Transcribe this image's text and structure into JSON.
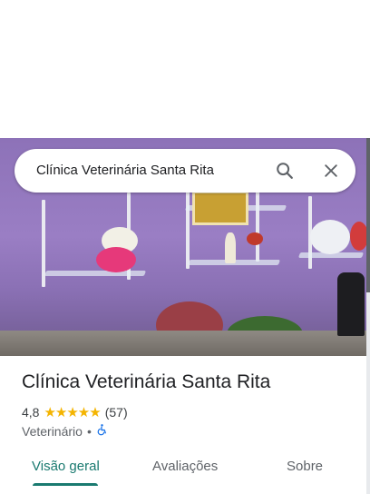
{
  "search": {
    "query": "Clínica Veterinária Santa Rita",
    "search_icon": "search-icon",
    "close_icon": "close-icon"
  },
  "place": {
    "name": "Clínica Veterinária Santa Rita",
    "rating": "4,8",
    "stars": "★★★★★",
    "review_count": "(57)",
    "category": "Veterinário",
    "separator": "•",
    "accessibility_icon": "wheelchair-icon"
  },
  "tabs": [
    {
      "label": "Visão geral",
      "active": true
    },
    {
      "label": "Avaliações",
      "active": false
    },
    {
      "label": "Sobre",
      "active": false
    }
  ],
  "colors": {
    "accent": "#1a7a70",
    "star": "#f4b400",
    "accessibility": "#1a73e8"
  }
}
